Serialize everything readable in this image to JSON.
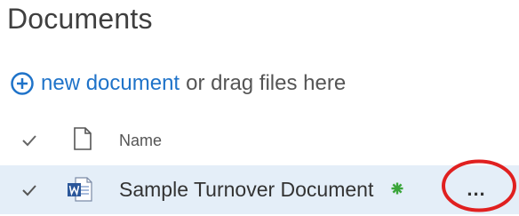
{
  "page": {
    "title": "Documents"
  },
  "actions": {
    "new_document_label": "new document",
    "drag_files_text": "or drag files here"
  },
  "list": {
    "header": {
      "name_label": "Name"
    },
    "rows": [
      {
        "name": "Sample Turnover Document",
        "file_type_icon": "word-document-icon",
        "is_new": true,
        "selected": true
      }
    ],
    "row_menu_label": "..."
  },
  "icons": {
    "add": "plus-circle-icon",
    "check": "checkmark-icon",
    "file": "file-icon",
    "new_item": "new-item-asterisk-icon"
  },
  "colors": {
    "link": "#1f73c9",
    "selected_row": "#e4eef8",
    "new_badge": "#3aa53a",
    "highlight_annotation": "#e02020",
    "word_blue": "#2b579a"
  }
}
